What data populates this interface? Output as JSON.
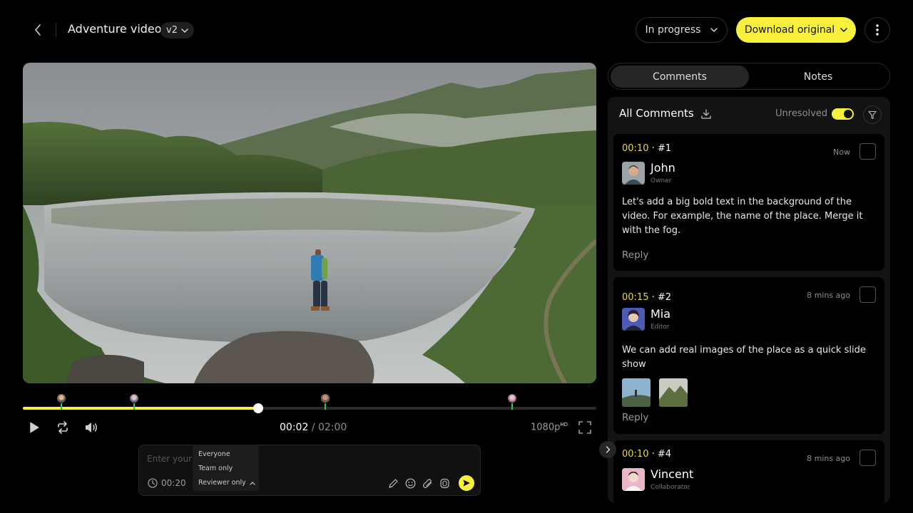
{
  "header": {
    "title": "Adventure video",
    "version": "v2",
    "status": "In progress",
    "download_label": "Download original"
  },
  "player": {
    "current_time": "00:02",
    "separator": "/",
    "total_time": "02:00",
    "quality": "1080p",
    "quality_badge": "HD",
    "progress_fraction": 0.41
  },
  "composer": {
    "placeholder": "Enter your comment",
    "timestamp": "00:20",
    "audience_options": [
      "Everyone",
      "Team only",
      "Reviewer only"
    ],
    "audience_selected": "Reviewer only"
  },
  "panel": {
    "tabs": [
      "Comments",
      "Notes"
    ],
    "active_tab": "Comments",
    "title": "All Comments",
    "filter_label": "Unresolved",
    "unresolved_on": true
  },
  "comments": [
    {
      "time": "00:10",
      "number": "#1",
      "posted": "Now",
      "author": "John",
      "role": "Owner",
      "text": "Let's add a big bold text in the background of the video. For example, the name of the place. Merge it with the fog.",
      "reply_label": "Reply"
    },
    {
      "time": "00:15",
      "number": "#2",
      "posted": "8 mins ago",
      "author": "Mia",
      "role": "Editor",
      "text": "We can add real images of the place as a quick slide show",
      "reply_label": "Reply"
    },
    {
      "time": "00:10",
      "number": "#4",
      "posted": "8 mins ago",
      "author": "Vincent",
      "role": "Collaborator"
    }
  ],
  "colors": {
    "accent": "#f7f03d",
    "background": "#000000",
    "panel": "#131313",
    "marker_tick": "#35c25f"
  },
  "icons": [
    "back-arrow-icon",
    "chevron-down-icon",
    "more-vertical-icon",
    "play-icon",
    "loop-icon",
    "volume-icon",
    "fullscreen-icon",
    "clock-icon",
    "pen-icon",
    "emoji-icon",
    "attach-icon",
    "voice-icon",
    "send-icon",
    "download-icon",
    "filter-icon",
    "chevron-right-icon"
  ]
}
